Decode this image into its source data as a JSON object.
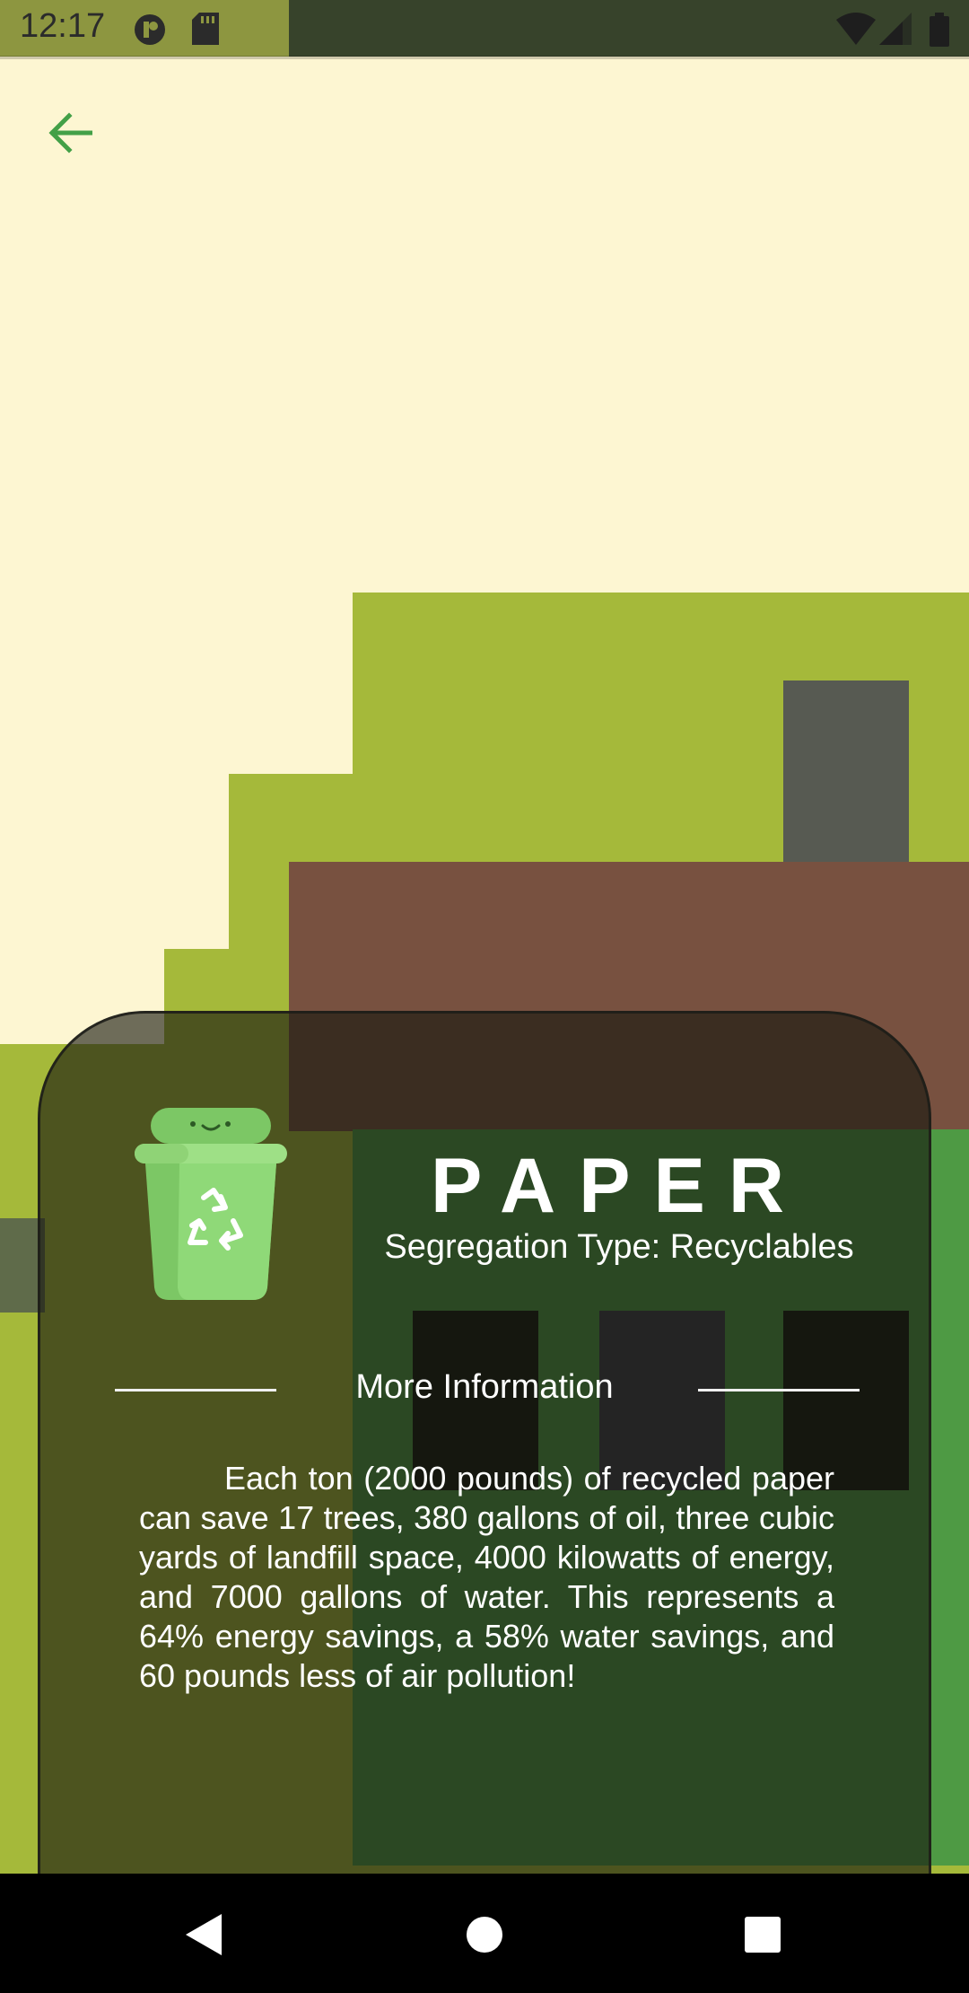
{
  "status_bar": {
    "time": "12:17",
    "icons": [
      "notification-app-icon",
      "sd-card-icon",
      "wifi-icon",
      "signal-icon",
      "battery-icon"
    ]
  },
  "toolbar": {
    "back_icon": "arrow-left-icon"
  },
  "card": {
    "icon": "recycle-bin-icon",
    "title": "PAPER",
    "segregation_type": "Segregation Type: Recyclables",
    "section_heading": "More Information",
    "description": "Each ton (2000 pounds) of recycled paper can save 17 trees, 380 gallons of oil, three cubic yards of landfill space, 4000 kilowatts of energy, and 7000 gallons of water. This represents a 64% energy savings, a 58% water savings, and 60 pounds less of air pollution!"
  },
  "nav_bar": {
    "back": "nav-back-icon",
    "home": "nav-home-icon",
    "recents": "nav-recents-icon"
  },
  "colors": {
    "background": "#fdf6d2",
    "accent_green": "#43a047",
    "card_overlay": "#16160e"
  }
}
